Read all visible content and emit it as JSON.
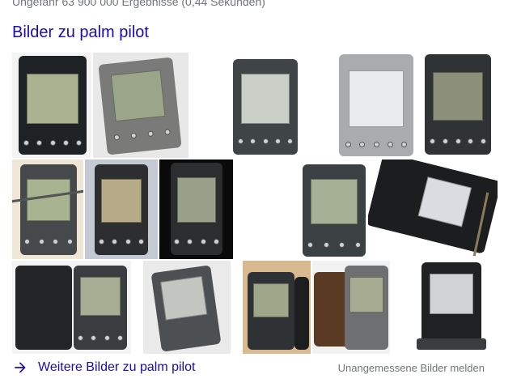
{
  "results": {
    "stats": "Ungefähr 63 900 000 Ergebnisse (0,44 Sekunden)"
  },
  "images_section": {
    "heading": "Bilder zu palm pilot",
    "more_link": "Weitere Bilder zu palm pilot",
    "report_link": "Unangemessene Bilder melden"
  },
  "colors": {
    "link": "#1a0dab",
    "muted": "#70757a"
  },
  "icons": {
    "more": "arrow-right-icon"
  }
}
